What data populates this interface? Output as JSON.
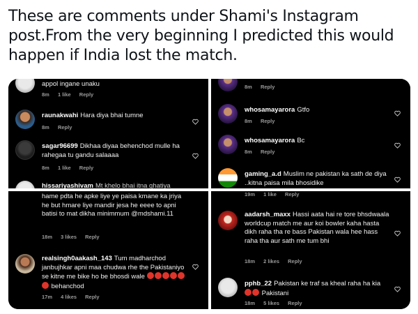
{
  "tweet": {
    "text": "These are comments under Shami's Instagram post.From the very beginning I predicted this would happen if India lost the match."
  },
  "panels": {
    "top_left": {
      "c1": {
        "user": "",
        "text": "appol ingane unaku",
        "time": "8m",
        "likes": "1 like",
        "reply": "Reply"
      },
      "c2": {
        "user": "raunakwahi",
        "text": "Hara diya bhai tumne",
        "time": "8m",
        "reply": "Reply"
      },
      "c3": {
        "user": "sagar96699",
        "text": "Dikhaa diyaa behenchod mulle ha rahegaa tu gandu salaaaa",
        "time": "8m",
        "likes": "1 like",
        "reply": "Reply"
      },
      "c4": {
        "user": "hissariyashivam",
        "text": "Mt khelo bhai itna ghatiya"
      }
    },
    "top_right": {
      "c1": {
        "time": "8m",
        "reply": "Reply"
      },
      "c2": {
        "user": "whosamayarora",
        "text": "Gtfo",
        "time": "8m",
        "reply": "Reply"
      },
      "c3": {
        "user": "whosamayarora",
        "text": "Bc",
        "time": "8m",
        "reply": "Reply"
      },
      "c4": {
        "user": "gaming_a.d",
        "text": "Muslim ne pakistan ka sath de diya ..kitna paisa mila bhosidike"
      }
    },
    "bottom_left": {
      "c1": {
        "text": "hame pdta he apke liye ye paisa kmane ka jriya he but hmare liye mandir jesa he eeee to apni batisi to mat dikha minimmum @mdshami.11",
        "time": "18m",
        "likes": "3 likes",
        "reply": "Reply"
      },
      "c2": {
        "user": "realsingh0aakash_143",
        "text": "Tum madharchod janbujhkar apni maa chudwa rhe the Pakistaniyo se kitne me bike ho be bhosdi wale",
        "text_end": "behanchod",
        "time": "17m",
        "likes": "4 likes",
        "reply": "Reply"
      }
    },
    "bottom_right": {
      "c0": {
        "time": "19m",
        "likes": "1 like",
        "reply": "Reply"
      },
      "c1": {
        "user": "aadarsh_maxx",
        "text": "Hassi aata hai re tore bhsdwaala worldcup match me aur koi bowler kaha hasta dikh raha tha re bass Pakistan wala hee hass raha tha aur sath me tum bhi",
        "time": "18m",
        "likes": "2 likes",
        "reply": "Reply"
      },
      "c2": {
        "user": "pphb_22",
        "text": "Pakistan ke traf sa kheal raha ha kia",
        "text_end": "Pakistani",
        "time": "18m",
        "likes": "5 likes",
        "reply": "Reply"
      }
    }
  },
  "colors": {
    "background": "#000000",
    "text": "#f2f2f2",
    "meta": "#9a9a9a",
    "tweet_text": "#0f1419"
  },
  "icons": [
    "heart-outline-icon",
    "red-face-emoji-icon"
  ]
}
